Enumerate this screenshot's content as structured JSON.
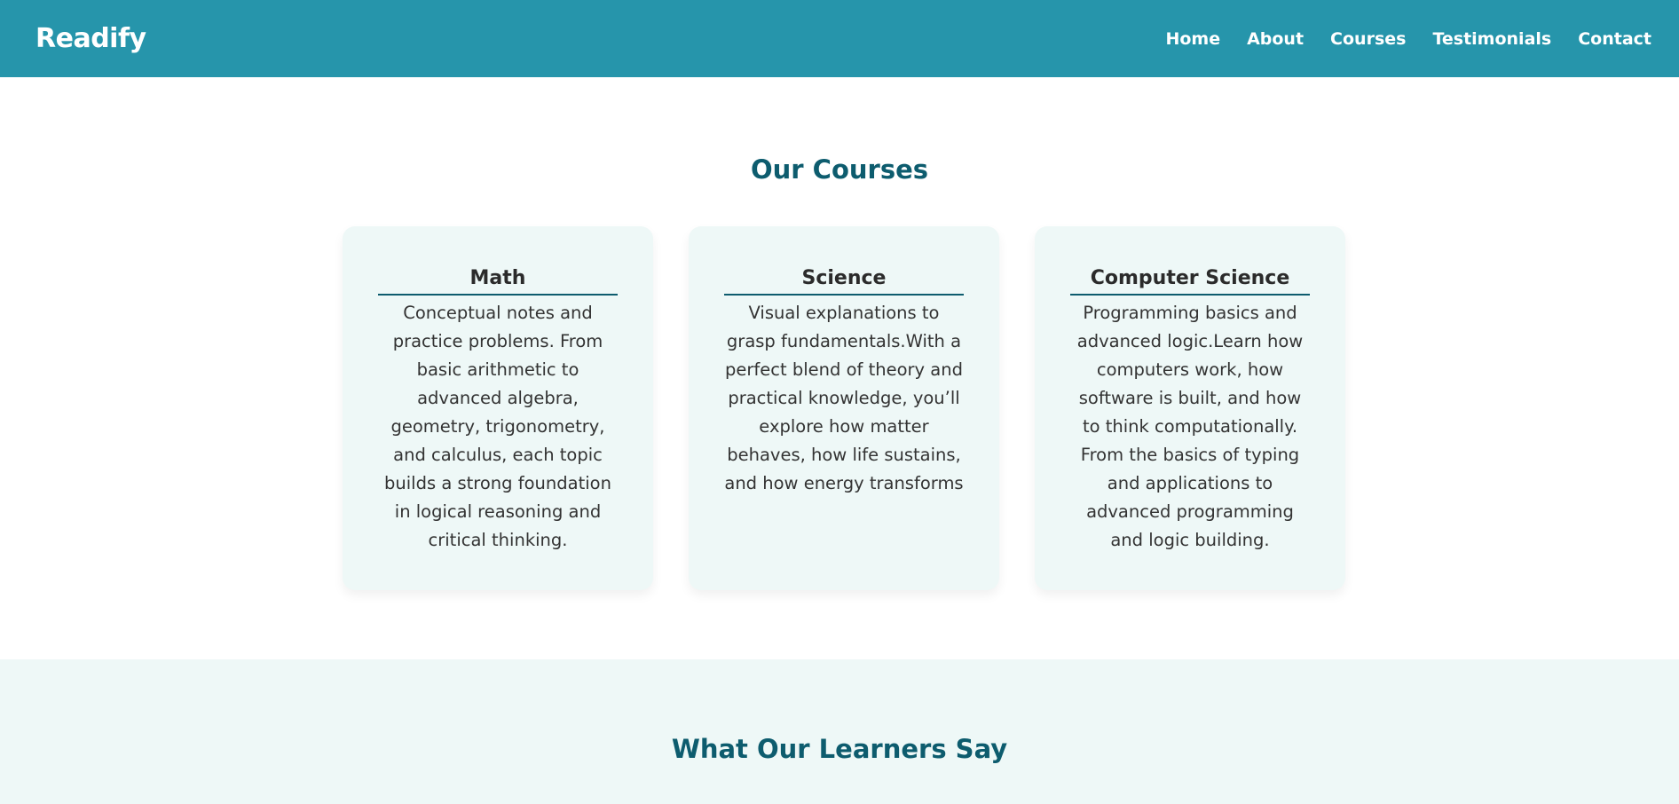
{
  "nav": {
    "brand": "Readify",
    "links": [
      "Home",
      "About",
      "Courses",
      "Testimonials",
      "Contact"
    ]
  },
  "courses": {
    "title": "Our Courses",
    "cards": [
      {
        "title": "Math",
        "text": "Conceptual notes and practice problems. From basic arithmetic to advanced algebra, geometry, trigonometry, and calculus, each topic builds a strong foundation in logical reasoning and critical thinking."
      },
      {
        "title": "Science",
        "text": "Visual explanations to grasp fundamentals.With a perfect blend of theory and practical knowledge, you’ll explore how matter behaves, how life sustains, and how energy transforms"
      },
      {
        "title": "Computer Science",
        "text": "Programming basics and advanced logic.Learn how computers work, how software is built, and how to think computationally. From the basics of typing and applications to advanced programming and logic building."
      }
    ]
  },
  "testimonials": {
    "title": "What Our Learners Say"
  },
  "colors": {
    "header": "#2695ab",
    "heading": "#0d5c6e",
    "card_bg": "#eef8f7"
  }
}
